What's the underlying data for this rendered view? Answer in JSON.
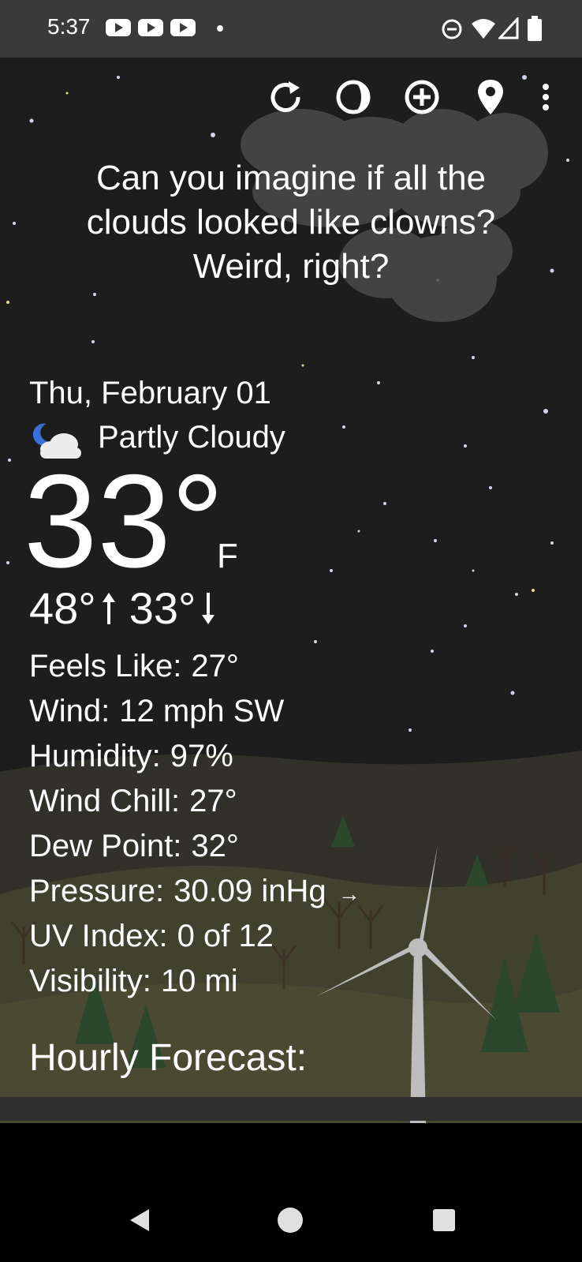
{
  "status_bar": {
    "time": "5:37"
  },
  "toolbar": {
    "refresh": "refresh-icon",
    "theme": "moon-phase-icon",
    "add": "add-location-icon",
    "location": "location-pin-icon",
    "menu": "overflow-menu-icon"
  },
  "quote": {
    "line1": "Can you imagine if all the",
    "line2": "clouds looked like clowns?",
    "line3": "Weird, right?"
  },
  "current": {
    "date": "Thu, February 01",
    "condition": "Partly Cloudy",
    "condition_icon": "partly-cloudy-night-icon",
    "temperature": "33°",
    "unit": "F",
    "high": "48°",
    "low": "33°"
  },
  "details": [
    {
      "label": "Feels Like:",
      "value": "27°"
    },
    {
      "label": "Wind:",
      "value": "12 mph SW"
    },
    {
      "label": "Humidity:",
      "value": "97%"
    },
    {
      "label": "Wind Chill:",
      "value": "27°"
    },
    {
      "label": "Dew Point:",
      "value": "32°"
    },
    {
      "label": "Pressure:",
      "value": "30.09 inHg",
      "trend": "→"
    },
    {
      "label": "UV Index:",
      "value": "0 of 12"
    },
    {
      "label": "Visibility:",
      "value": "10 mi"
    }
  ],
  "hourly": {
    "title": "Hourly Forecast:"
  },
  "colors": {
    "background": "#1c1c1c",
    "status_bar": "#3a3a3a",
    "navbar": "#000000",
    "text": "#ffffff"
  }
}
